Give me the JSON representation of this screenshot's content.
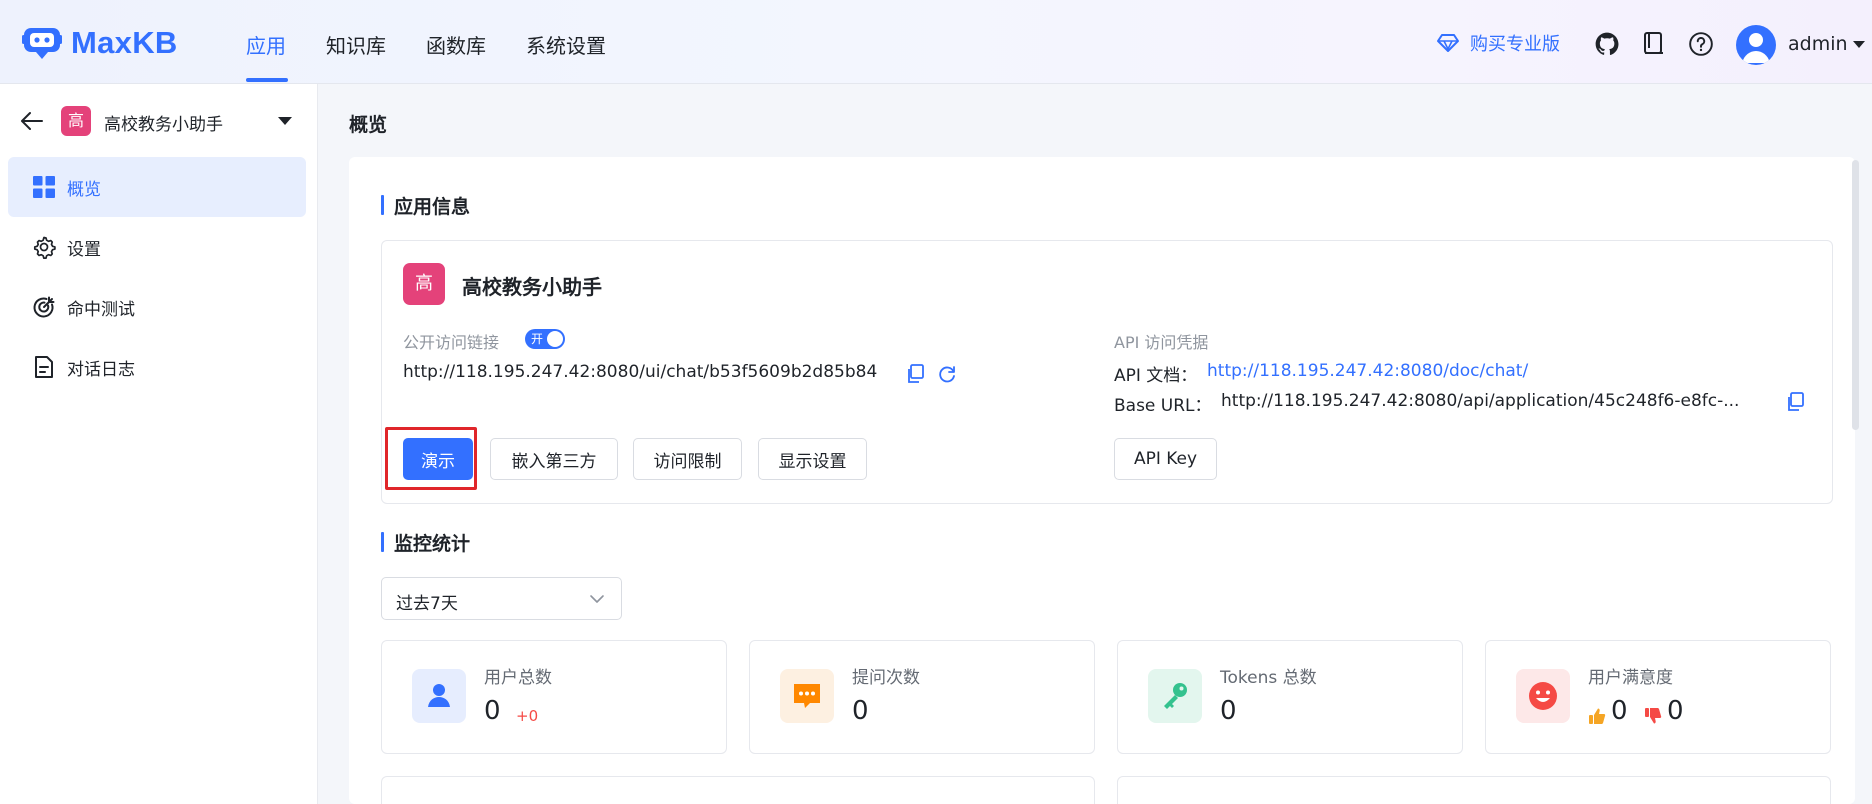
{
  "header": {
    "logo_text": "MaxKB",
    "nav": [
      {
        "label": "应用",
        "active": true
      },
      {
        "label": "知识库",
        "active": false
      },
      {
        "label": "函数库",
        "active": false
      },
      {
        "label": "系统设置",
        "active": false
      }
    ],
    "buy_pro": "购买专业版",
    "icons": [
      "github-icon",
      "docs-icon",
      "help-icon"
    ],
    "user": "admin"
  },
  "sidebar": {
    "app_badge": "高",
    "app_name": "高校教务小助手",
    "menu": [
      {
        "label": "概览",
        "icon": "grid-icon",
        "active": true
      },
      {
        "label": "设置",
        "icon": "gear-icon",
        "active": false
      },
      {
        "label": "命中测试",
        "icon": "target-icon",
        "active": false
      },
      {
        "label": "对话日志",
        "icon": "document-icon",
        "active": false
      }
    ]
  },
  "main": {
    "page_title": "概览",
    "app_info": {
      "section_title": "应用信息",
      "app_badge": "高",
      "app_name": "高校教务小助手",
      "public_link_label": "公开访问链接",
      "toggle_label": "开",
      "toggle_on": true,
      "public_url": "http://118.195.247.42:8080/ui/chat/b53f5609b2d85b84",
      "api_label": "API 访问凭据",
      "api_doc_label": "API 文档：",
      "api_doc_url": "http://118.195.247.42:8080/doc/chat/",
      "base_url_label": "Base URL：",
      "base_url": "http://118.195.247.42:8080/api/application/45c248f6-e8fc-...",
      "buttons": {
        "demo": "演示",
        "embed": "嵌入第三方",
        "access_limit": "访问限制",
        "display_settings": "显示设置",
        "api_key": "API Key"
      }
    },
    "monitor": {
      "section_title": "监控统计",
      "range_select": "过去7天",
      "stats": [
        {
          "label": "用户总数",
          "value": "0",
          "delta": "+0",
          "icon": "user-icon",
          "color": "#3370ff",
          "bg": "#e6edfe"
        },
        {
          "label": "提问次数",
          "value": "0",
          "icon": "chat-icon",
          "color": "#ff8800",
          "bg": "#fdf0e1"
        },
        {
          "label": "Tokens 总数",
          "value": "0",
          "icon": "key-icon",
          "color": "#34c28e",
          "bg": "#e3f6ee"
        },
        {
          "label": "用户满意度",
          "like": "0",
          "dislike": "0",
          "icon": "smile-icon",
          "color": "#f54a45",
          "bg": "#fde8e8"
        }
      ]
    }
  },
  "colors": {
    "accent": "#3370ff",
    "badge": "#e4427a",
    "highlight": "#e0262a"
  }
}
